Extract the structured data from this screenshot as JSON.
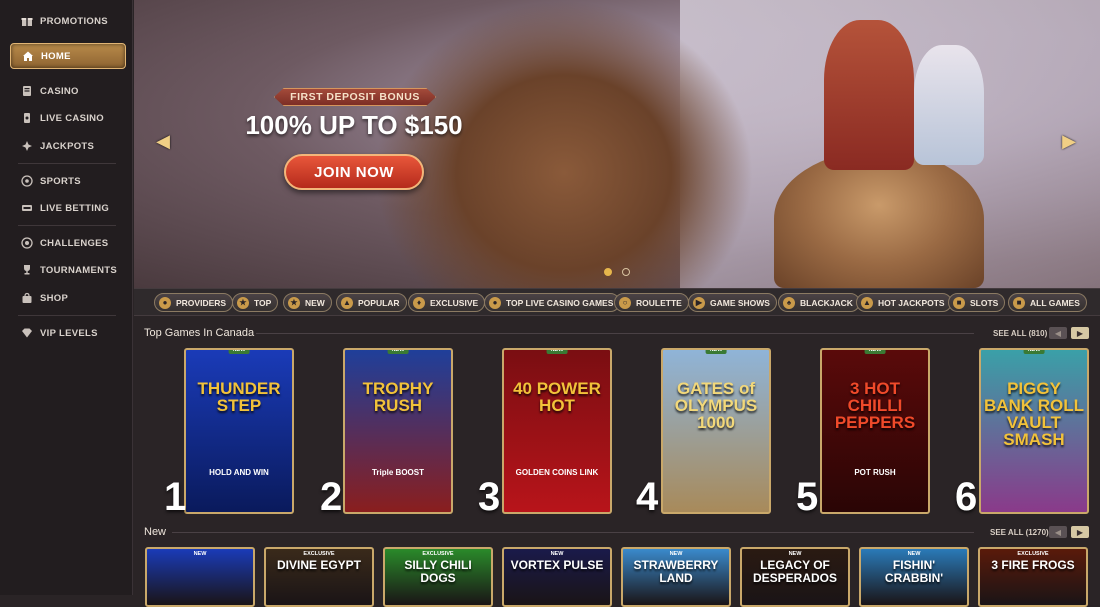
{
  "sidebar": {
    "items": [
      {
        "label": "PROMOTIONS",
        "icon": "gift-icon"
      },
      {
        "label": "HOME",
        "icon": "home-icon",
        "active": true
      },
      {
        "label": "CASINO",
        "icon": "casino-icon"
      },
      {
        "label": "LIVE CASINO",
        "icon": "live-casino-icon"
      },
      {
        "label": "JACKPOTS",
        "icon": "jackpots-icon"
      },
      {
        "label": "SPORTS",
        "icon": "soccer-ball-icon"
      },
      {
        "label": "LIVE BETTING",
        "icon": "live-betting-icon"
      },
      {
        "label": "CHALLENGES",
        "icon": "target-icon"
      },
      {
        "label": "TOURNAMENTS",
        "icon": "trophy-icon"
      },
      {
        "label": "SHOP",
        "icon": "shopping-bag-icon"
      },
      {
        "label": "VIP LEVELS",
        "icon": "diamond-icon"
      }
    ]
  },
  "hero": {
    "badge": "FIRST DEPOSIT BONUS",
    "title": "100% UP TO $150",
    "cta": "JOIN NOW",
    "prev_icon": "chevron-left-icon",
    "next_icon": "chevron-right-icon",
    "active_slide": 1,
    "slide_count": 2
  },
  "categories": [
    {
      "label": "PROVIDERS",
      "icon": "providers-icon"
    },
    {
      "label": "TOP",
      "icon": "top-icon"
    },
    {
      "label": "NEW",
      "icon": "new-icon"
    },
    {
      "label": "POPULAR",
      "icon": "flame-icon"
    },
    {
      "label": "EXCLUSIVE",
      "icon": "exclusive-icon"
    },
    {
      "label": "TOP LIVE CASINO GAMES",
      "icon": "live-icon"
    },
    {
      "label": "ROULETTE",
      "icon": "roulette-icon"
    },
    {
      "label": "GAME SHOWS",
      "icon": "game-shows-icon"
    },
    {
      "label": "BLACKJACK",
      "icon": "cards-icon"
    },
    {
      "label": "HOT JACKPOTS",
      "icon": "jackpot-icon"
    },
    {
      "label": "SLOTS",
      "icon": "slots-icon"
    },
    {
      "label": "ALL GAMES",
      "icon": "all-games-icon"
    }
  ],
  "top_games": {
    "title": "Top Games In Canada",
    "see_all": "SEE ALL (810)",
    "new_tag": "NEW",
    "games": [
      {
        "rank": "1",
        "name": "THUNDER STEP",
        "sub": "HOLD AND WIN",
        "bg_top": "#1a3bb8",
        "bg_bottom": "#0a1a5c",
        "accent": "#f2c23a"
      },
      {
        "rank": "2",
        "name": "TROPHY RUSH",
        "sub": "Triple BOOST",
        "bg_top": "#1f3f9a",
        "bg_bottom": "#8a1e1e",
        "accent": "#f2c23a"
      },
      {
        "rank": "3",
        "name": "40 POWER HOT",
        "sub": "GOLDEN COINS LINK",
        "bg_top": "#7a0e12",
        "bg_bottom": "#b8141a",
        "accent": "#f2c23a"
      },
      {
        "rank": "4",
        "name": "GATES of OLYMPUS 1000",
        "sub": "",
        "bg_top": "#8fb4d8",
        "bg_bottom": "#a88a5a",
        "accent": "#f2d87a"
      },
      {
        "rank": "5",
        "name": "3 HOT CHILLI PEPPERS",
        "sub": "POT RUSH",
        "bg_top": "#5a0a0a",
        "bg_bottom": "#2a0505",
        "accent": "#f04a2a"
      },
      {
        "rank": "6",
        "name": "PIGGY BANK ROLL VAULT SMASH",
        "sub": "",
        "bg_top": "#3aa0a8",
        "bg_bottom": "#8a3a8a",
        "accent": "#f2c23a"
      }
    ]
  },
  "new_games": {
    "title": "New",
    "see_all": "SEE ALL (1270)",
    "games": [
      {
        "name": "",
        "sub": "NEW",
        "bg": "#1a3bb8"
      },
      {
        "name": "DIVINE EGYPT",
        "sub": "EXCLUSIVE",
        "bg": "#3a2a1a"
      },
      {
        "name": "SILLY CHILI DOGS",
        "sub": "EXCLUSIVE",
        "bg": "#2a8a2a"
      },
      {
        "name": "VORTEX PULSE",
        "sub": "NEW",
        "bg": "#1a1a4a"
      },
      {
        "name": "STRAWBERRY LAND",
        "sub": "NEW",
        "bg": "#3a8acc"
      },
      {
        "name": "LEGACY OF DESPERADOS",
        "sub": "NEW",
        "bg": "#2a1a12"
      },
      {
        "name": "FISHIN' CRABBIN'",
        "sub": "NEW",
        "bg": "#2a7ab8"
      },
      {
        "name": "3 FIRE FROGS",
        "sub": "EXCLUSIVE",
        "bg": "#5a1a0a"
      }
    ]
  }
}
